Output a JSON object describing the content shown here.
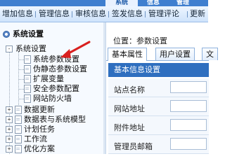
{
  "top_tabs": [
    {
      "label": "系统",
      "active": true
    },
    {
      "label": "信息",
      "active": false
    },
    {
      "label": "管理",
      "active": false
    }
  ],
  "menu": [
    {
      "label": "增加信息"
    },
    {
      "label": "管理信息"
    },
    {
      "label": "审核信息"
    },
    {
      "label": "签发信息"
    },
    {
      "label": "管理评论"
    },
    {
      "label": "更新"
    }
  ],
  "tree": {
    "root": {
      "label": "系统设置",
      "icon": "gear-icon"
    },
    "root_expander": "-",
    "items": [
      {
        "label": "系统设置",
        "expander": "-"
      },
      {
        "label": "系统参数设置"
      },
      {
        "label": "伪静态参数设置"
      },
      {
        "label": "扩展变量"
      },
      {
        "label": "安全参数配置"
      },
      {
        "label": "网站防火墙"
      },
      {
        "label": "数据更新",
        "expander": "+"
      },
      {
        "label": "数据表与系统模型",
        "expander": "+"
      },
      {
        "label": "计划任务",
        "expander": "+"
      },
      {
        "label": "工作流",
        "expander": "+"
      },
      {
        "label": "优化方案",
        "expander": "+"
      }
    ]
  },
  "content": {
    "breadcrumb": "位置：参数设置",
    "tabs": [
      {
        "label": "基本属性",
        "active": true
      },
      {
        "label": "用户设置",
        "active": false
      },
      {
        "label": "文",
        "active": false
      }
    ],
    "section_header": "基本信息设置",
    "fields": [
      {
        "label": "站点名称"
      },
      {
        "label": "网站地址"
      },
      {
        "label": "附件地址"
      },
      {
        "label": "管理员邮箱"
      }
    ]
  },
  "colors": {
    "accent": "#2f6fbf",
    "annotation_arrow": "#d9201f"
  }
}
